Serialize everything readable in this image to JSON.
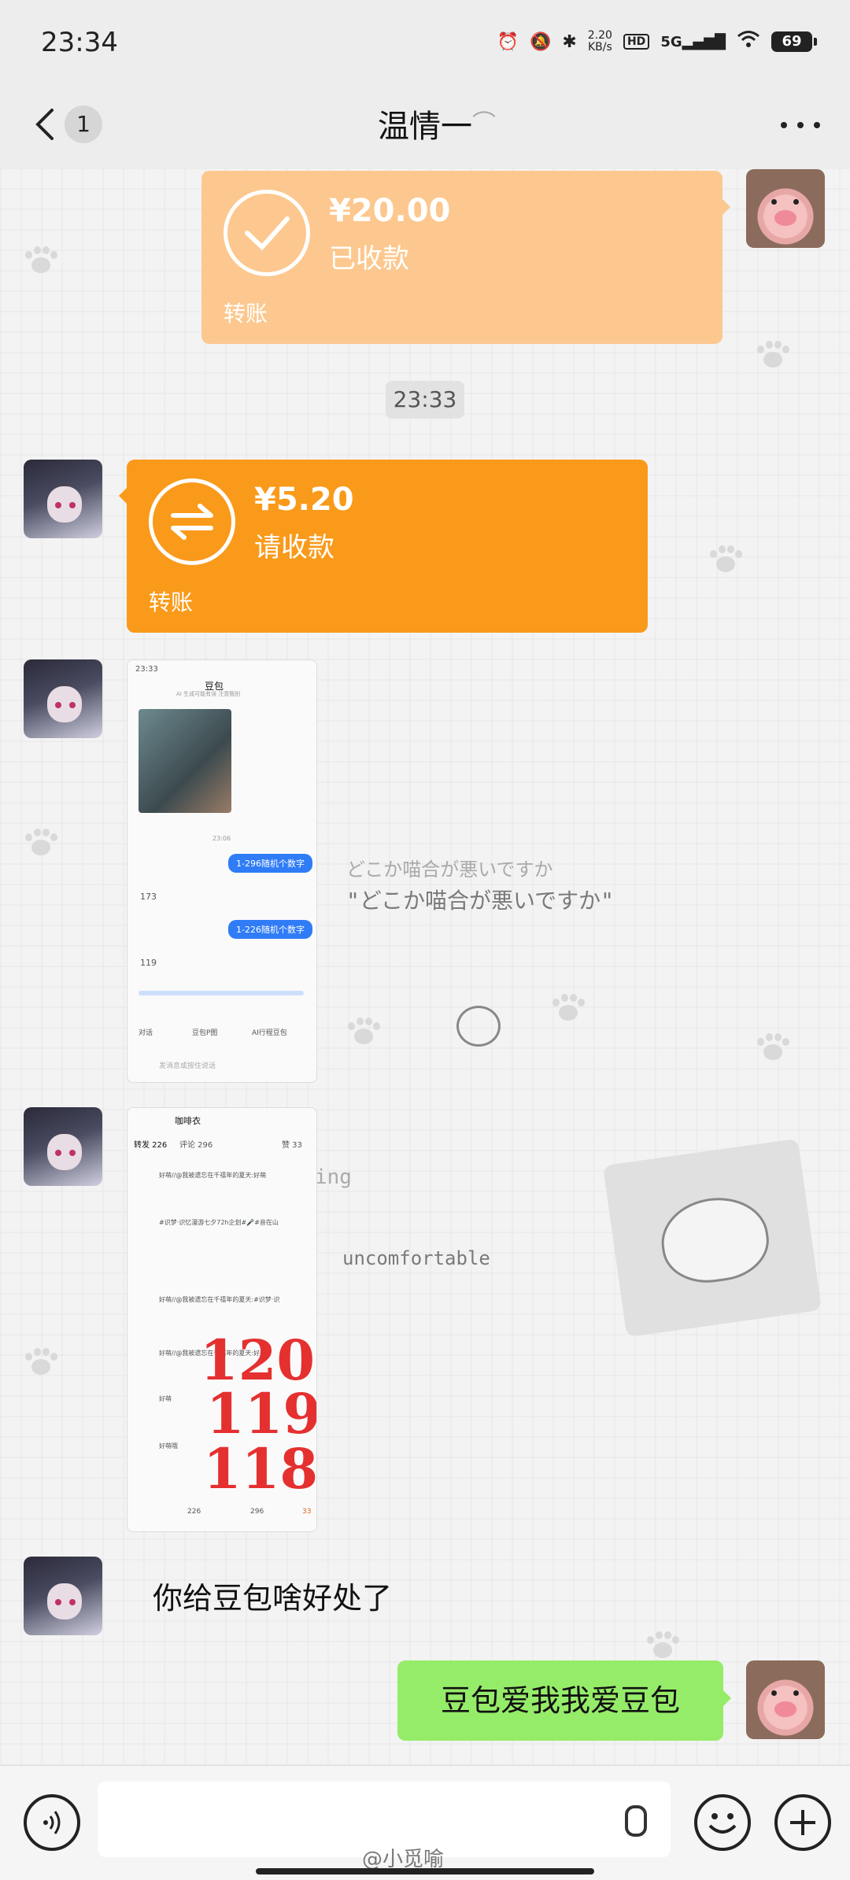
{
  "status_bar": {
    "time": "23:34",
    "net_speed": "2.20",
    "net_speed_unit": "KB/s",
    "hd": "HD",
    "signal": "5G",
    "battery": "69"
  },
  "header": {
    "unread_count": "1",
    "title": "温情一",
    "back_icon": "chevron-left-icon",
    "more_icon": "ellipsis-icon",
    "ear_icon": "ear-icon"
  },
  "messages": {
    "sent_transfer": {
      "amount": "¥20.00",
      "state": "已收款",
      "kind": "转账",
      "color": "#fcc88f"
    },
    "timestamp": "23:33",
    "received_transfer": {
      "amount": "¥5.20",
      "state": "请收款",
      "kind": "转账",
      "color": "#fa9a1a"
    },
    "screenshot1": {
      "time": "23:33",
      "title": "豆包",
      "subtitle": "AI 生成可能有误 注意甄别",
      "center_time": "23:06",
      "bubble1": "1-296随机个数字",
      "reply1": "173",
      "bubble2": "1-226随机个数字",
      "reply2": "119",
      "tab1": "对话",
      "tab2": "豆包P图",
      "tab3": "AI行程豆包",
      "input_placeholder": "发消息或按住说话"
    },
    "screenshot2": {
      "title": "咖啡衣",
      "tab1": "转发 226",
      "tab2": "评论 296",
      "tab3": "赞 33",
      "line1": "好萌//@我被遗忘在千禧年的夏天:好萌",
      "line2": "#识梦·识忆漫游七夕72h企划#🎤#音在山",
      "line3": "好萌//@我被遗忘在千禧年的夏天:#识梦·识",
      "line4": "好萌//@我被遗忘在千禧年的夏天:好萌",
      "line5": "好萌",
      "line6": "好萌哦",
      "n1": "120",
      "n2": "119",
      "n3": "118",
      "repost_count": "226",
      "comment_count": "296",
      "like_count": "33"
    },
    "left_text": "你给豆包啥好处了",
    "right_text": "豆包爱我我爱豆包"
  },
  "background": {
    "jp_text_1": "どこか喵合が悪いですか",
    "jp_text_2": "\"どこか喵合が悪いですか\"",
    "en_text": "uncomfortable",
    "ing_text": "ing"
  },
  "input_bar": {
    "voice_icon": "voice-icon",
    "mic_icon": "mic-icon",
    "emoji_icon": "emoji-icon",
    "plus_icon": "plus-icon"
  },
  "watermark": "@小觅喻"
}
